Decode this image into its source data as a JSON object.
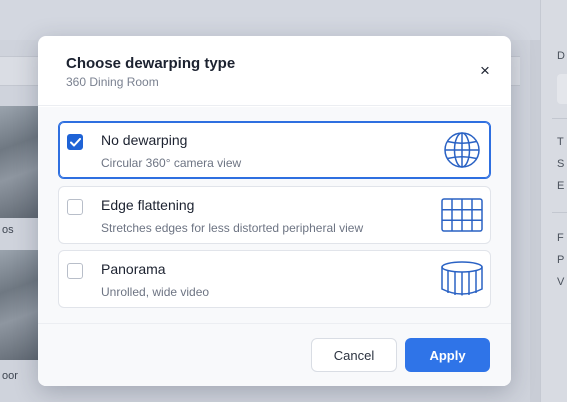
{
  "background": {
    "camera_labels": [
      "os",
      "oor"
    ],
    "right_panel_letters": [
      "D",
      "T",
      "S",
      "E",
      "F",
      "P",
      "V"
    ]
  },
  "dialog": {
    "title": "Choose dewarping type",
    "subtitle": "360 Dining Room",
    "close_label": "×",
    "options": [
      {
        "title": "No dewarping",
        "description": "Circular 360° camera view",
        "checked": true,
        "icon": "globe-icon"
      },
      {
        "title": "Edge flattening",
        "description": "Stretches edges for less distorted peripheral view",
        "checked": false,
        "icon": "grid-icon"
      },
      {
        "title": "Panorama",
        "description": "Unrolled, wide video",
        "checked": false,
        "icon": "panorama-cylinder-icon"
      }
    ],
    "cancel_label": "Cancel",
    "apply_label": "Apply"
  },
  "colors": {
    "accent": "#2f74e8",
    "icon_stroke": "#2a62c4"
  }
}
